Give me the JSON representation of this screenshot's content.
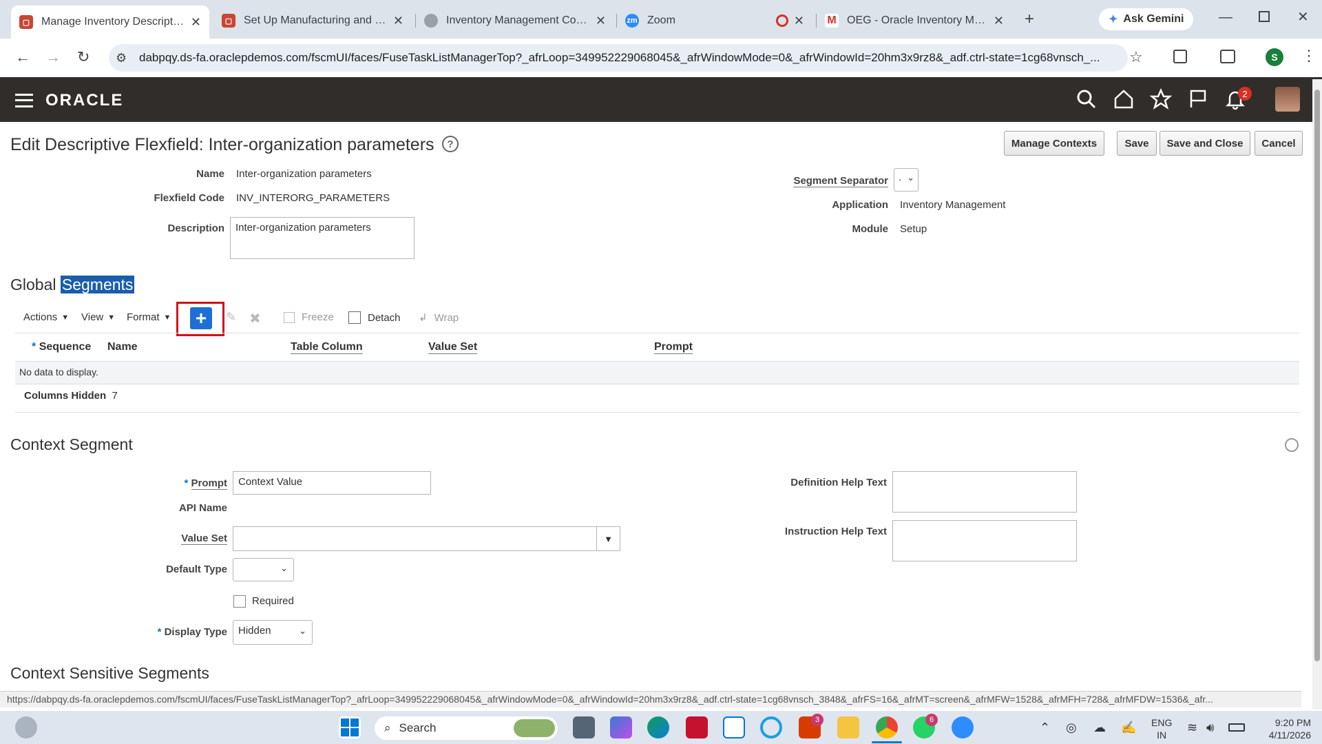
{
  "browser": {
    "tabs": [
      {
        "title": "Manage Inventory Descriptive",
        "icon": "oracle-tab-icon"
      },
      {
        "title": "Set Up Manufacturing and Sup",
        "icon": "oracle-tab-icon"
      },
      {
        "title": "Inventory Management Config",
        "icon": "globe-icon"
      },
      {
        "title": "Zoom",
        "icon": "zoom-icon"
      },
      {
        "title": "OEG - Oracle Inventory Manag",
        "icon": "gmail-icon"
      }
    ],
    "ask_gemini": "Ask Gemini",
    "url": "dabpqy.ds-fa.oraclepdemos.com/fscmUI/faces/FuseTaskListManagerTop?_afrLoop=349952229068045&_afrWindowMode=0&_afrWindowId=20hm3x9rz8&_adf.ctrl-state=1cg68vnsch_...",
    "profile_initial": "S",
    "status_url": "https://dabpqy.ds-fa.oraclepdemos.com/fscmUI/faces/FuseTaskListManagerTop?_afrLoop=349952229068045&_afrWindowMode=0&_afrWindowId=20hm3x9rz8&_adf.ctrl-state=1cg68vnsch_3848&_afrFS=16&_afrMT=screen&_afrMFW=1528&_afrMFH=728&_afrMFDW=1536&_afr..."
  },
  "oracle": {
    "logo": "ORACLE",
    "notification_count": "2"
  },
  "page": {
    "title": "Edit Descriptive Flexfield: Inter-organization parameters",
    "buttons": {
      "manage_contexts": "Manage Contexts",
      "save": "Save",
      "save_close": "Save and Close",
      "cancel": "Cancel"
    },
    "fields": {
      "name_label": "Name",
      "name_value": "Inter-organization parameters",
      "code_label": "Flexfield Code",
      "code_value": "INV_INTERORG_PARAMETERS",
      "desc_label": "Description",
      "desc_value": "Inter-organization parameters",
      "sep_label": "Segment Separator",
      "sep_value": ".",
      "app_label": "Application",
      "app_value": "Inventory Management",
      "module_label": "Module",
      "module_value": "Setup"
    }
  },
  "global_segments": {
    "heading_a": "Global ",
    "heading_b": "Segments",
    "toolbar": {
      "actions": "Actions",
      "view": "View",
      "format": "Format",
      "freeze": "Freeze",
      "detach": "Detach",
      "wrap": "Wrap"
    },
    "columns": [
      "Sequence",
      "Name",
      "Table Column",
      "Value Set",
      "Prompt"
    ],
    "empty": "No data to display.",
    "hidden_label": "Columns Hidden",
    "hidden_count": "7"
  },
  "context_segment": {
    "heading": "Context Segment",
    "prompt_label": "Prompt",
    "prompt_value": "Context Value",
    "api_label": "API Name",
    "valueset_label": "Value Set",
    "default_type_label": "Default Type",
    "required_label": "Required",
    "display_type_label": "Display Type",
    "display_type_value": "Hidden",
    "def_help_label": "Definition Help Text",
    "instr_help_label": "Instruction Help Text"
  },
  "context_sensitive": {
    "heading": "Context Sensitive Segments"
  },
  "taskbar": {
    "search": "Search",
    "lang1": "ENG",
    "lang2": "IN",
    "time": "9:20 PM",
    "date": "4/11/2026",
    "badges": {
      "office": "3",
      "whatsapp": "6"
    }
  }
}
